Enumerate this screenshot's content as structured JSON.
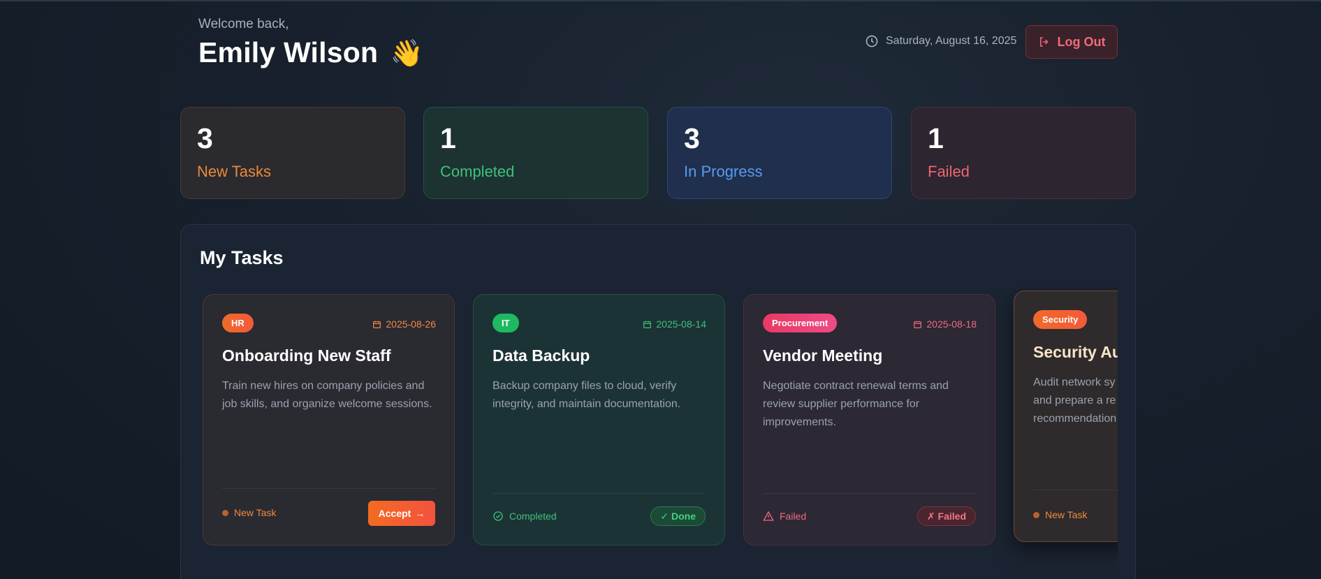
{
  "header": {
    "welcome": "Welcome back,",
    "user_name": "Emily Wilson",
    "wave": "👋",
    "date": "Saturday, August 16, 2025",
    "logout_label": "Log Out"
  },
  "stats": [
    {
      "value": "3",
      "label": "New Tasks",
      "color": "#ea8a3c"
    },
    {
      "value": "1",
      "label": "Completed",
      "color": "#3fc17a"
    },
    {
      "value": "3",
      "label": "In Progress",
      "color": "#5a9af0"
    },
    {
      "value": "1",
      "label": "Failed",
      "color": "#ee6672"
    }
  ],
  "tasks_panel": {
    "title": "My Tasks",
    "cards": [
      {
        "category": "HR",
        "date": "2025-08-26",
        "title": "Onboarding New Staff",
        "description": "Train new hires on company policies and job skills, and organize welcome sessions.",
        "status": "New Task",
        "action": "Accept",
        "action_icon": "→"
      },
      {
        "category": "IT",
        "date": "2025-08-14",
        "title": "Data Backup",
        "description": "Backup company files to cloud, verify integrity, and maintain documentation.",
        "status": "Completed",
        "badge": "✓ Done"
      },
      {
        "category": "Procurement",
        "date": "2025-08-18",
        "title": "Vendor Meeting",
        "description": "Negotiate contract renewal terms and review supplier performance for improvements.",
        "status": "Failed",
        "badge": "✗ Failed"
      },
      {
        "category": "Security",
        "title": "Security Au",
        "description": "Audit network sy and prepare a re recommendation",
        "status": "New Task"
      }
    ]
  },
  "colors": {
    "accent_orange": "#f3523e",
    "success": "#3fc17a",
    "danger": "#ee6672",
    "info": "#5a9af0"
  }
}
